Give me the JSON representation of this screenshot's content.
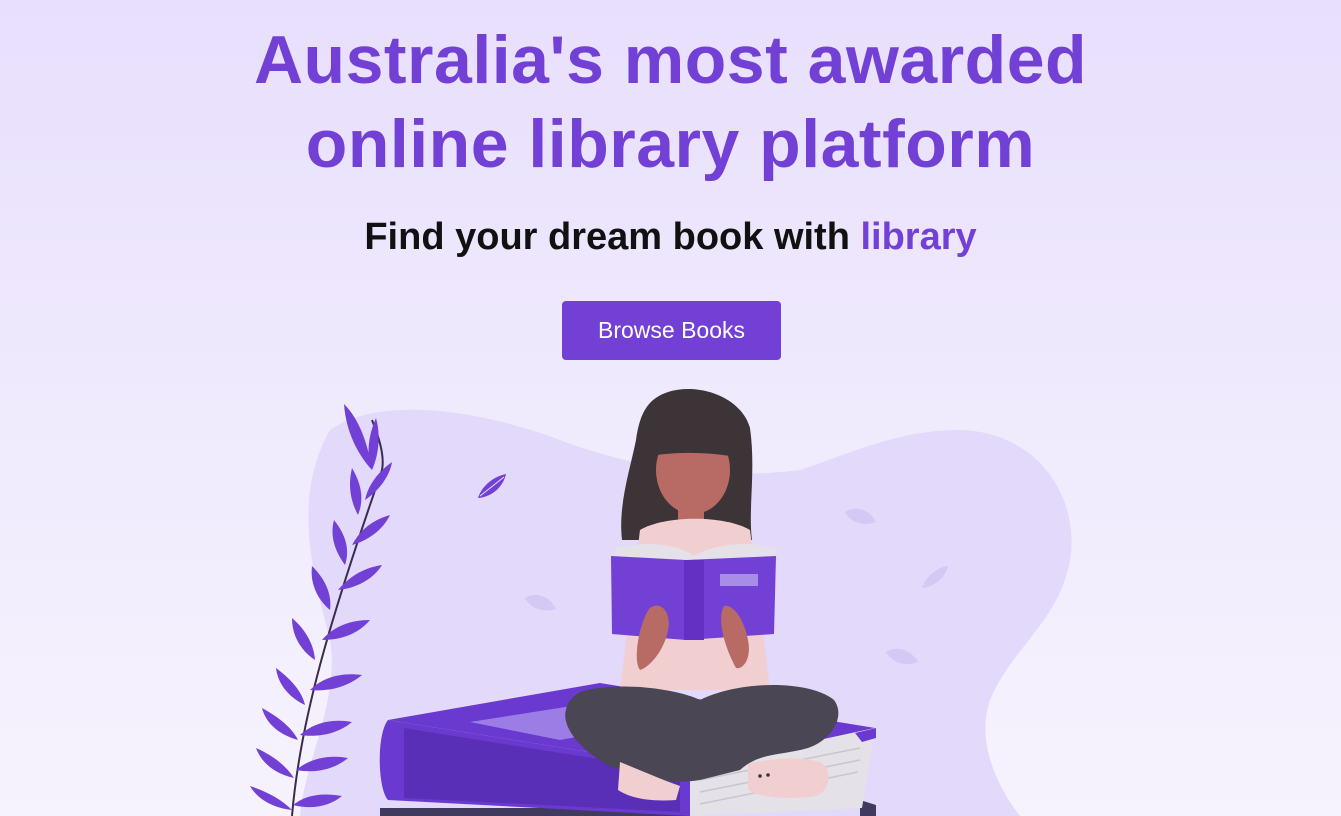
{
  "hero": {
    "title_line1": "Australia's most awarded",
    "title_line2": "online library platform",
    "subtitle_prefix": "Find your dream book with",
    "subtitle_accent": "library",
    "browse_button_label": "Browse Books"
  },
  "colors": {
    "accent": "#7340d6",
    "background_top": "#e8dffd",
    "background_bottom": "#f6f3fd",
    "blob": "#e2d9fb",
    "text_dark": "#111111"
  },
  "illustration": {
    "icon": "woman-reading-on-books-illustration"
  }
}
